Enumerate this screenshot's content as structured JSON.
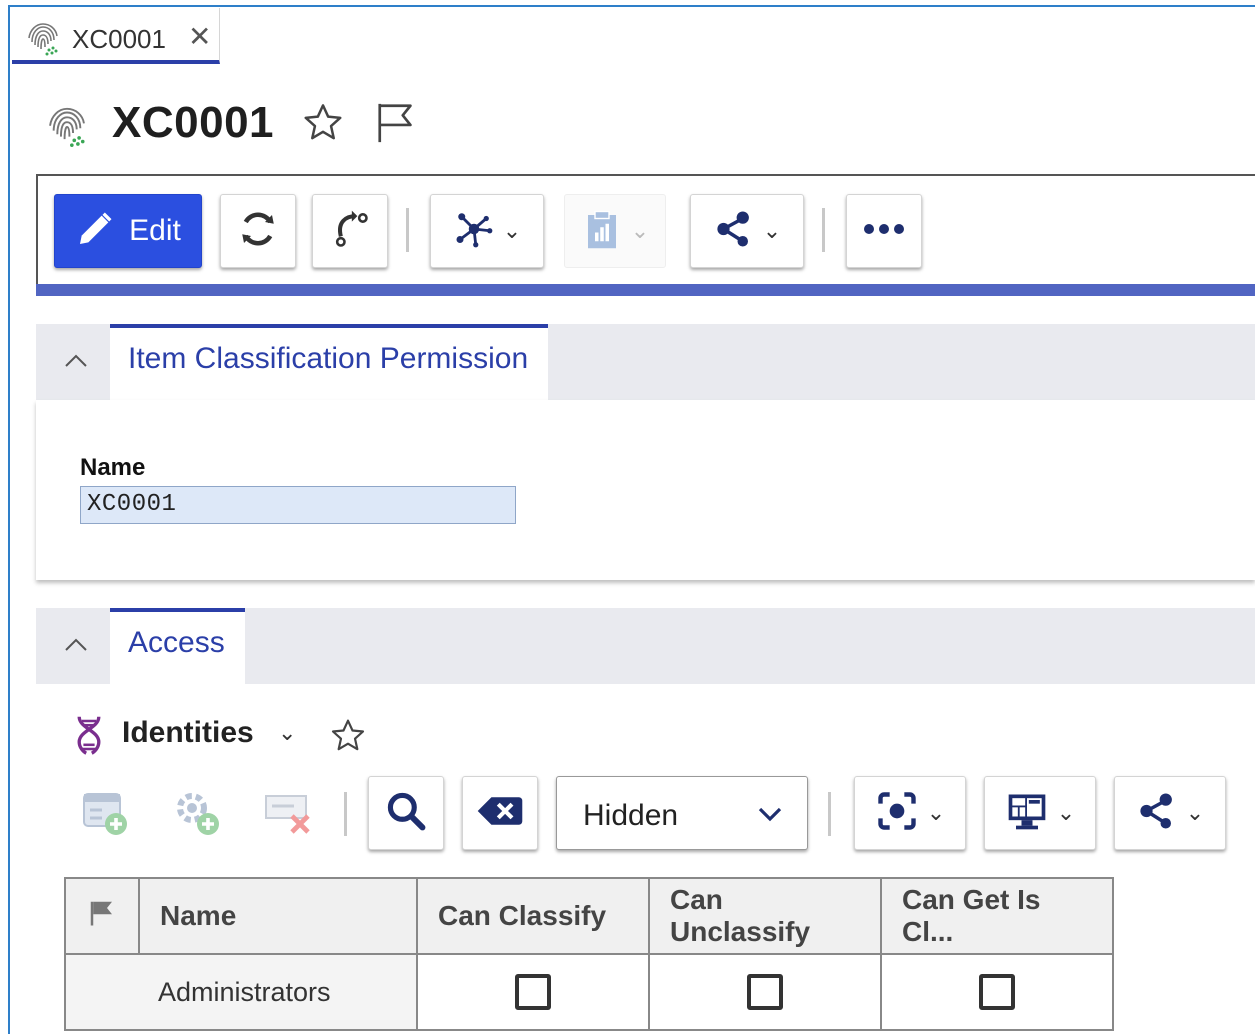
{
  "tab": {
    "label": "XC0001",
    "close": "✕",
    "icon": "fingerprint-icon"
  },
  "header": {
    "title": "XC0001",
    "icons": [
      "fingerprint-icon",
      "star-icon",
      "flag-icon"
    ]
  },
  "toolbar": {
    "edit_label": "Edit",
    "buttons": [
      "edit",
      "refresh",
      "promote",
      "structure-browser",
      "reports",
      "share",
      "more"
    ]
  },
  "section1": {
    "title": "Item Classification Permission",
    "name_label": "Name",
    "name_value": "XC0001"
  },
  "section2": {
    "title": "Access",
    "relationship_title": "Identities",
    "filter_select": "Hidden",
    "grid": {
      "columns": [
        "Name",
        "Can Classify",
        "Can Unclassify",
        "Can Get Is Cl..."
      ],
      "rows": [
        {
          "name": "Administrators",
          "can_classify": false,
          "can_unclassify": false,
          "can_get_is_classified": false
        }
      ]
    }
  },
  "colors": {
    "accent": "#2b3fa8",
    "primary_button": "#2b4fe0",
    "toolbar_bar": "#5165c2",
    "frame": "#2e7fc9"
  }
}
